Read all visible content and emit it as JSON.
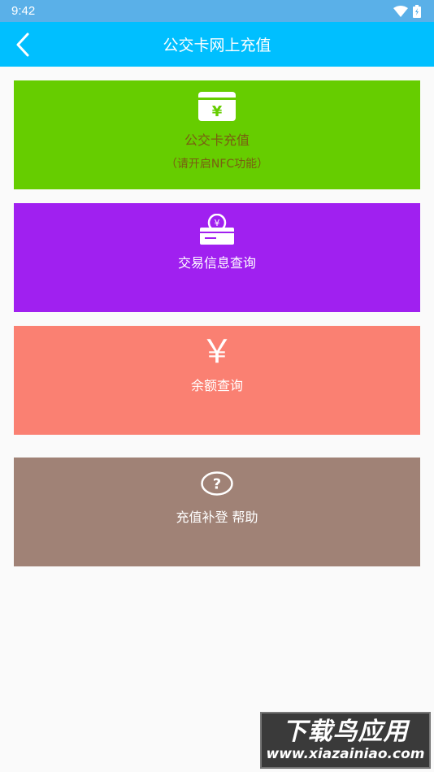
{
  "status_bar": {
    "time": "9:42",
    "icons": [
      "wifi-icon",
      "battery-charging-icon"
    ]
  },
  "app_bar": {
    "title": "公交卡网上充值",
    "back_icon": "chevron-left-icon",
    "color": "#00bfff"
  },
  "cards": [
    {
      "label": "公交卡充值",
      "sublabel": "（请开启NFC功能）",
      "icon": "yuan-card-icon",
      "color": "#66cd00"
    },
    {
      "label": "交易信息查询",
      "icon": "yuan-coin-receipt-icon",
      "color": "#a020f0"
    },
    {
      "label": "余额查询",
      "icon": "yuan-icon",
      "icon_glyph": "￥",
      "color": "#fa8072"
    },
    {
      "label": "充值补登 帮助",
      "icon": "question-circle-icon",
      "color": "#a08276"
    }
  ],
  "watermark": {
    "line1": "下载鸟应用",
    "line2": "www.xiazainiao.com"
  }
}
